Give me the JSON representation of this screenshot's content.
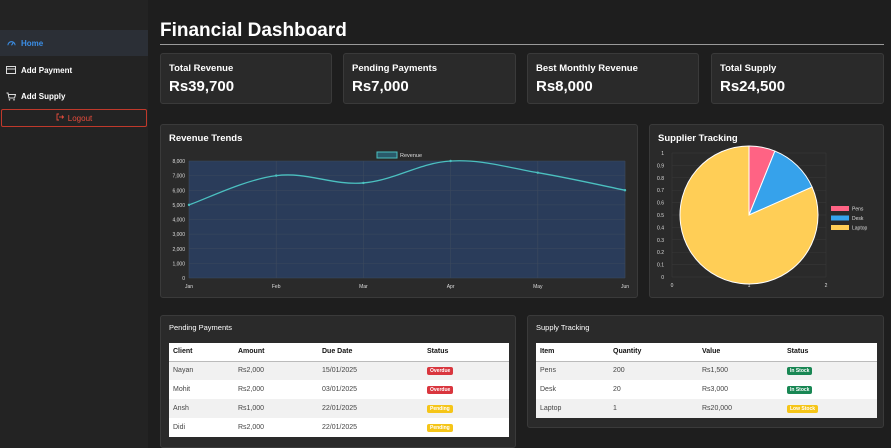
{
  "sidebar": {
    "items": [
      {
        "label": "Home",
        "icon": "dashboard-icon"
      },
      {
        "label": "Add Payment",
        "icon": "payment-icon"
      },
      {
        "label": "Add Supply",
        "icon": "cart-icon"
      }
    ],
    "logout": "Logout"
  },
  "page": {
    "title": "Financial Dashboard"
  },
  "stats": [
    {
      "label": "Total Revenue",
      "value": "Rs39,700"
    },
    {
      "label": "Pending Payments",
      "value": "Rs7,000"
    },
    {
      "label": "Best Monthly Revenue",
      "value": "Rs8,000"
    },
    {
      "label": "Total Supply",
      "value": "Rs24,500"
    }
  ],
  "revenue_panel": {
    "title": "Revenue Trends"
  },
  "supplier_panel": {
    "title": "Supplier Tracking"
  },
  "chart_data": [
    {
      "type": "area",
      "title": "Revenue Trends",
      "categories": [
        "Jan",
        "Feb",
        "Mar",
        "Apr",
        "May",
        "Jun"
      ],
      "series": [
        {
          "name": "Revenue",
          "values": [
            5000,
            7000,
            6500,
            8000,
            7200,
            6000
          ]
        }
      ],
      "ylim": [
        0,
        8000
      ],
      "yticks": [
        "0",
        "1,000",
        "2,000",
        "3,000",
        "4,000",
        "5,000",
        "6,000",
        "7,000",
        "8,000"
      ],
      "grid": true,
      "legend": "top-center",
      "colors": {
        "line": "#4bc0c0",
        "fill": "#2a3c5a"
      }
    },
    {
      "type": "pie",
      "title": "Supplier Tracking",
      "categories": [
        "Pens",
        "Desk",
        "Laptop"
      ],
      "values": [
        1500,
        3000,
        20000
      ],
      "colors": [
        "#ff6384",
        "#36a2eb",
        "#ffce56"
      ],
      "xticks": [
        "0",
        "1",
        "2"
      ],
      "yticks": [
        "0",
        "0.1",
        "0.2",
        "0.3",
        "0.4",
        "0.5",
        "0.6",
        "0.7",
        "0.8",
        "0.9",
        "1"
      ],
      "legend": "right"
    }
  ],
  "pending": {
    "title": "Pending Payments",
    "headers": [
      "Client",
      "Amount",
      "Due Date",
      "Status"
    ],
    "rows": [
      {
        "client": "Nayan",
        "amount": "Rs2,000",
        "due": "15/01/2025",
        "status": "Overdue",
        "status_color": "#d9363e"
      },
      {
        "client": "Mohit",
        "amount": "Rs2,000",
        "due": "03/01/2025",
        "status": "Overdue",
        "status_color": "#d9363e"
      },
      {
        "client": "Ansh",
        "amount": "Rs1,000",
        "due": "22/01/2025",
        "status": "Pending",
        "status_color": "#f5c518"
      },
      {
        "client": "Didi",
        "amount": "Rs2,000",
        "due": "22/01/2025",
        "status": "Pending",
        "status_color": "#f5c518"
      }
    ]
  },
  "supply": {
    "title": "Supply Tracking",
    "headers": [
      "Item",
      "Quantity",
      "Value",
      "Status"
    ],
    "rows": [
      {
        "item": "Pens",
        "qty": "200",
        "value": "Rs1,500",
        "status": "In Stock",
        "status_color": "#198754"
      },
      {
        "item": "Desk",
        "qty": "20",
        "value": "Rs3,000",
        "status": "In Stock",
        "status_color": "#198754"
      },
      {
        "item": "Laptop",
        "qty": "1",
        "value": "Rs20,000",
        "status": "Low Stock",
        "status_color": "#f5c518"
      }
    ]
  }
}
